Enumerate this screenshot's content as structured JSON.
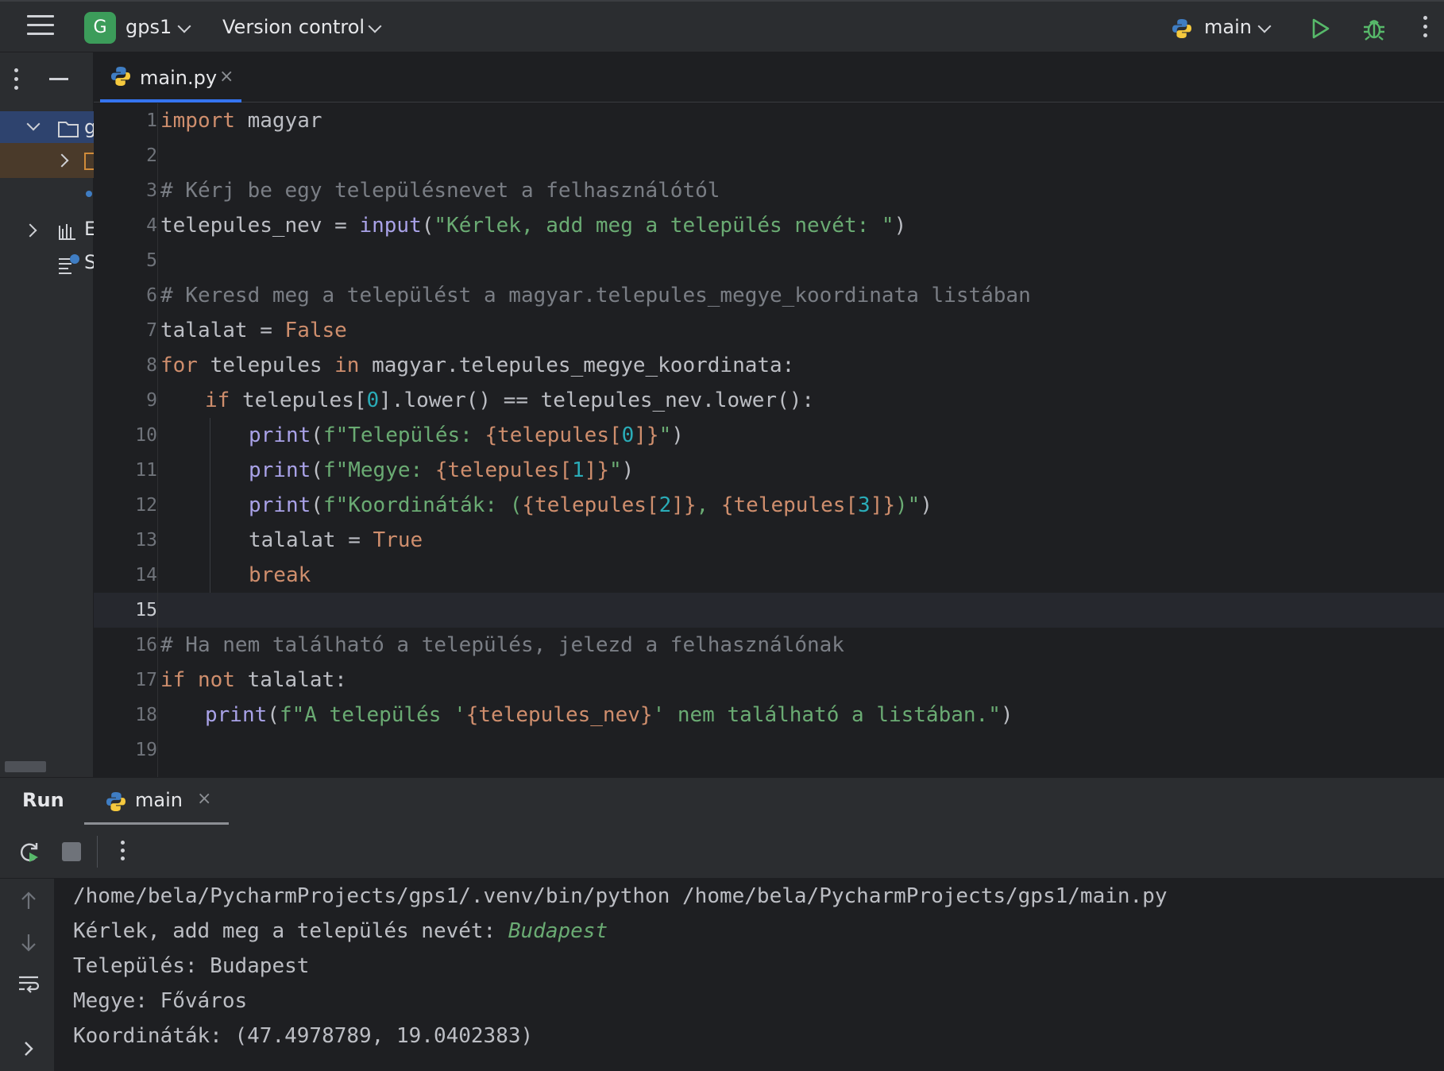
{
  "colors": {
    "background": "#1e1f22",
    "panel": "#2b2d30",
    "keyword": "#cf8e6d",
    "comment": "#7a7e85",
    "string": "#6aab73",
    "builtin": "#a9a2e8",
    "number": "#2aacb8",
    "accent": "#3574f0",
    "project_badge": "#3c9c5a"
  },
  "toolbar": {
    "menu_icon": "hamburger-icon",
    "project_badge": "G",
    "project_name": "gps1",
    "version_control": "Version control",
    "run_config": "main",
    "run_icon": "play-icon",
    "debug_icon": "bug-icon"
  },
  "project_panel": {
    "partial_labels": [
      "g",
      "E",
      "S"
    ]
  },
  "editor": {
    "tab_label": "main.py",
    "tab_close": "×",
    "current_line": 15,
    "line_numbers": [
      "1",
      "2",
      "3",
      "4",
      "5",
      "6",
      "7",
      "8",
      "9",
      "10",
      "11",
      "12",
      "13",
      "14",
      "15",
      "16",
      "17",
      "18",
      "19"
    ]
  },
  "run_panel": {
    "title": "Run",
    "tab_label": "main",
    "tab_close": "×",
    "console": {
      "command": "/home/bela/PycharmProjects/gps1/.venv/bin/python /home/bela/PycharmProjects/gps1/main.py",
      "prompt": "Kérlek, add meg a település nevét: ",
      "user_input": "Budapest",
      "out1": "Település: Budapest",
      "out2": "Megye: Főváros",
      "out3": "Koordináták: (47.4978789, 19.0402383)"
    }
  },
  "code": {
    "l1": [
      "import",
      " magyar"
    ],
    "l3": "# Kérj be egy településnevet a felhasználótól",
    "l4": [
      "telepules_nev = ",
      "input",
      "(",
      "\"Kérlek, add meg a település nevét: \"",
      ")"
    ],
    "l6": "# Keresd meg a települést a magyar.telepules_megye_koordinata listában",
    "l7": [
      "talalat = ",
      "False"
    ],
    "l8": [
      "for",
      " telepules ",
      "in",
      " magyar.telepules_megye_koordinata:"
    ],
    "l9": [
      "if",
      " telepules[",
      "0",
      "].lower() == telepules_nev.lower():"
    ],
    "l10": [
      "print",
      "(",
      "f\"Település: ",
      "{telepules[",
      "0",
      "]}",
      "\"",
      ")"
    ],
    "l11": [
      "print",
      "(",
      "f\"Megye: ",
      "{telepules[",
      "1",
      "]}",
      "\"",
      ")"
    ],
    "l12": [
      "print",
      "(",
      "f\"Koordináták: (",
      "{telepules[",
      "2",
      "]}",
      ", ",
      "{telepules[",
      "3",
      "]}",
      ")\"",
      ")"
    ],
    "l13": [
      "talalat = ",
      "True"
    ],
    "l14": "break",
    "l16": "# Ha nem található a település, jelezd a felhasználónak",
    "l17": [
      "if",
      " ",
      "not",
      " talalat:"
    ],
    "l18": [
      "print",
      "(",
      "f\"A település '",
      "{telepules_nev}",
      "' nem található a listában.\"",
      ")"
    ]
  }
}
